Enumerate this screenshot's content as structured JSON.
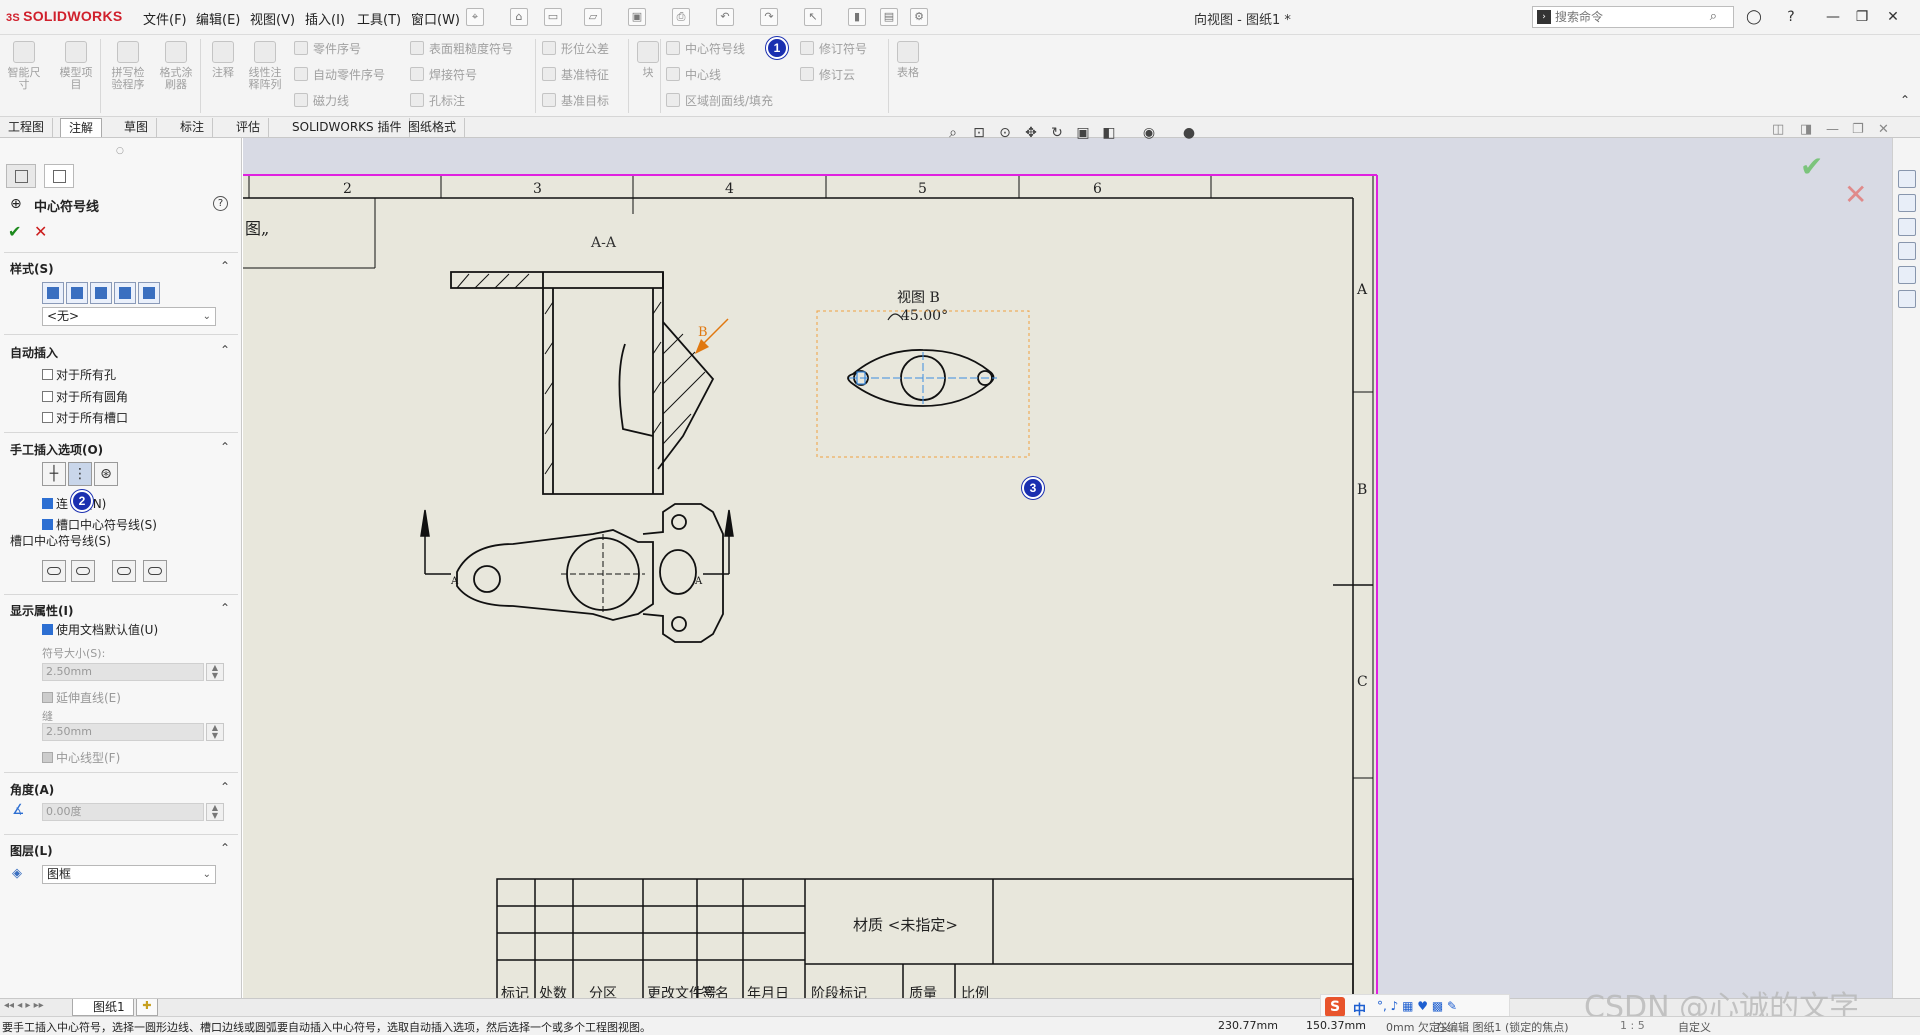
{
  "app": {
    "logo_ds": "3S",
    "logo_text": "SOLIDWORKS",
    "doc_title": "向视图 - 图纸1 *"
  },
  "menu": [
    "文件(F)",
    "编辑(E)",
    "视图(V)",
    "插入(I)",
    "工具(T)",
    "窗口(W)"
  ],
  "search": {
    "placeholder": "搜索命令"
  },
  "ribbon": {
    "smart_dim": "智能尺寸",
    "model_items": "模型项目",
    "spell": "拼写检验程序",
    "format_painter": "格式涂刷器",
    "note": "注释",
    "linear_note": "线性注释阵列",
    "balloon": "零件序号",
    "auto_balloon": "自动零件序号",
    "magnetic_line": "磁力线",
    "surface_finish": "表面粗糙度符号",
    "weld": "焊接符号",
    "hole_callout": "孔标注",
    "gtol": "形位公差",
    "datum_feature": "基准特征",
    "datum_target": "基准目标",
    "block": "块",
    "center_mark": "中心符号线",
    "centerline": "中心线",
    "area_hatch": "区域剖面线/填充",
    "revision_symbol": "修订符号",
    "revision_cloud": "修订云",
    "table": "表格"
  },
  "tabs": [
    "工程图",
    "注解",
    "草图",
    "标注",
    "评估",
    "SOLIDWORKS 插件",
    "图纸格式"
  ],
  "markers": [
    "1",
    "2",
    "3"
  ],
  "pm": {
    "title": "中心符号线",
    "style_header": "样式(S)",
    "style_value": "<无>",
    "auto_insert_header": "自动插入",
    "auto_opts": [
      "对于所有孔",
      "对于所有圆角",
      "对于所有槽口"
    ],
    "manual_header": "手工插入选项(O)",
    "linked_label_a": "连",
    "linked_label_b": "(N)",
    "slot_centermark": "槽口中心符号线(S)",
    "slot_header": "槽口中心符号线(S)",
    "display_header": "显示属性(I)",
    "use_doc_default": "使用文档默认值(U)",
    "mark_size_label": "符号大小(S):",
    "mark_size_value": "2.50mm",
    "extended_lines": "延伸直线(E)",
    "gap_label": "缝",
    "gap_value": "2.50mm",
    "centerline_font": "中心线型(F)",
    "angle_header": "角度(A)",
    "angle_value": "0.00度",
    "layer_header": "图层(L)",
    "layer_value": "图框"
  },
  "drawing": {
    "zone_numbers": [
      "2",
      "3",
      "4",
      "5",
      "6"
    ],
    "zone_letters": [
      "A",
      "B",
      "C"
    ],
    "title_frag": "图„",
    "section_label": "A-A",
    "view_b_title": "视图 B",
    "view_b_angle": "45.00°",
    "arrow_b": "B",
    "section_arrow": "A",
    "material": "材质 <未指定>",
    "title_block_bottom": [
      "标记",
      "处数",
      "分区",
      "更改文件号",
      "签名",
      "年月日",
      "阶段标记",
      "质量",
      "比例"
    ]
  },
  "sheet_tab": "图纸1",
  "status": {
    "message": "要手工插入中心符号，选择一圆形边线、槽口边线或圆弧要自动插入中心符号，选取自动插入选项，然后选择一个或多个工程图视图。",
    "coord_x": "230.77mm",
    "coord_y": "150.37mm",
    "mode": "0mm 欠定义",
    "edit": "在编辑 图纸1 (锁定的焦点)",
    "scale": "1 : 5",
    "custom": "自定义"
  },
  "ime": {
    "lang": "中"
  },
  "watermark": "CSDN @心诚的文字"
}
